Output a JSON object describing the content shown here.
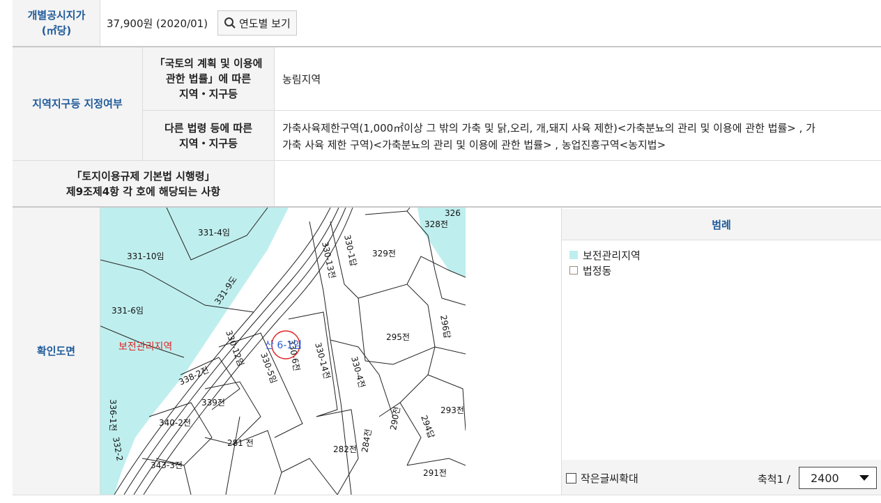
{
  "price_row": {
    "header": "개별공시지가\n(㎡당)",
    "value": "37,900원 (2020/01)",
    "button_label": "연도별 보기"
  },
  "zoning": {
    "header": "지역지구등 지정여부",
    "law1_header": "「국토의 계획 및 이용에\n관한 법률」에 따른\n지역・지구등",
    "law1_value": "농림지역",
    "law2_header": "다른 법령 등에 따른\n지역・지구등",
    "law2_value_line1": "가축사육제한구역(1,000㎡이상 그 밖의 가축 및 닭,오리, 개,돼지 사육 제한)<가축분뇨의 관리 및 이용에 관한 법률> , 가",
    "law2_value_line2": "가축 사육 제한 구역)<가축분뇨의 관리 및 이용에 관한 법률> , 농업진흥구역<농지법>"
  },
  "enforcement": {
    "header": "「토지이용규제 기본법 시행령」\n제9조제4항 각 호에 해당되는 사항",
    "value": ""
  },
  "map_section": {
    "header": "확인도면",
    "parcel_labels": [
      "331-4임",
      "331-10임",
      "331-6임",
      "331-9도",
      "330-13전",
      "330-1답",
      "329전",
      "328전",
      "326",
      "295전",
      "296답",
      "330-12임",
      "330-5임",
      "330-6전",
      "330-14전",
      "330-4전",
      "338-2전",
      "339전",
      "340-2전",
      "281 전",
      "343-3전",
      "282전",
      "284전",
      "290전",
      "291전",
      "293전",
      "294답",
      "336-1전",
      "332-2"
    ],
    "zone_label": "보전관리지역",
    "target_label": "산 6-1임",
    "zone_color": "#bfeeee"
  },
  "legend": {
    "title": "범례",
    "items": [
      {
        "label": "보전관리지역",
        "color": "#bfeeee"
      },
      {
        "label": "법정동",
        "color": "#a08a6c"
      }
    ],
    "enlarge_label": "작은글씨확대",
    "scale_label": "축척1 /",
    "scale_value": "2400"
  }
}
